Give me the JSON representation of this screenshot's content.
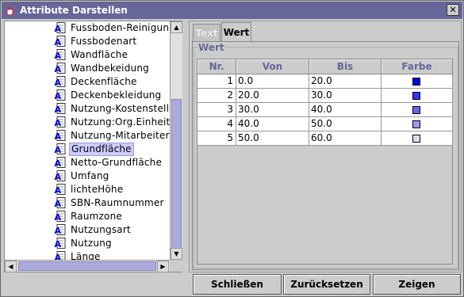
{
  "window": {
    "title": "Attribute Darstellen",
    "close_symbol": "✕"
  },
  "tree": {
    "items": [
      {
        "label": "Fussboden-Reinigung",
        "selected": false
      },
      {
        "label": "Fussbodenart",
        "selected": false
      },
      {
        "label": "Wandfläche",
        "selected": false
      },
      {
        "label": "Wandbekeidung",
        "selected": false
      },
      {
        "label": "Deckenfläche",
        "selected": false
      },
      {
        "label": "Deckenbekleidung",
        "selected": false
      },
      {
        "label": "Nutzung-Kostenstelle",
        "selected": false
      },
      {
        "label": "Nutzung:Org.Einheit",
        "selected": false
      },
      {
        "label": "Nutzung-Mitarbeiter",
        "selected": false
      },
      {
        "label": "Grundfläche",
        "selected": true
      },
      {
        "label": "Netto-Grundfläche",
        "selected": false
      },
      {
        "label": "Umfang",
        "selected": false
      },
      {
        "label": "lichteHöhe",
        "selected": false
      },
      {
        "label": "SBN-Raumnummer",
        "selected": false
      },
      {
        "label": "Raumzone",
        "selected": false
      },
      {
        "label": "Nutzungsart",
        "selected": false
      },
      {
        "label": "Nutzung",
        "selected": false
      },
      {
        "label": "Länge",
        "selected": false
      }
    ],
    "item_icon": "attribute-document-icon"
  },
  "tabs": [
    {
      "label": "Text",
      "active": false
    },
    {
      "label": "Wert",
      "active": true
    }
  ],
  "group": {
    "title": "Wert"
  },
  "table": {
    "headers": [
      "Nr.",
      "Von",
      "Bis",
      "Farbe"
    ],
    "rows": [
      {
        "nr": "1",
        "von": "0.0",
        "bis": "20.0",
        "color": "#0000ee"
      },
      {
        "nr": "2",
        "von": "20.0",
        "bis": "30.0",
        "color": "#3333ee"
      },
      {
        "nr": "3",
        "von": "30.0",
        "bis": "40.0",
        "color": "#6666ee"
      },
      {
        "nr": "4",
        "von": "40.0",
        "bis": "50.0",
        "color": "#9999ee"
      },
      {
        "nr": "5",
        "von": "50.0",
        "bis": "60.0",
        "color": "#ddddf4"
      }
    ]
  },
  "buttons": {
    "close": "Schließen",
    "reset": "Zurücksetzen",
    "show": "Zeigen"
  },
  "colors": {
    "titlebar": "#666699",
    "header_text": "#666699",
    "selection": "#ccccff",
    "scroll_thumb": "#aaaadd"
  }
}
